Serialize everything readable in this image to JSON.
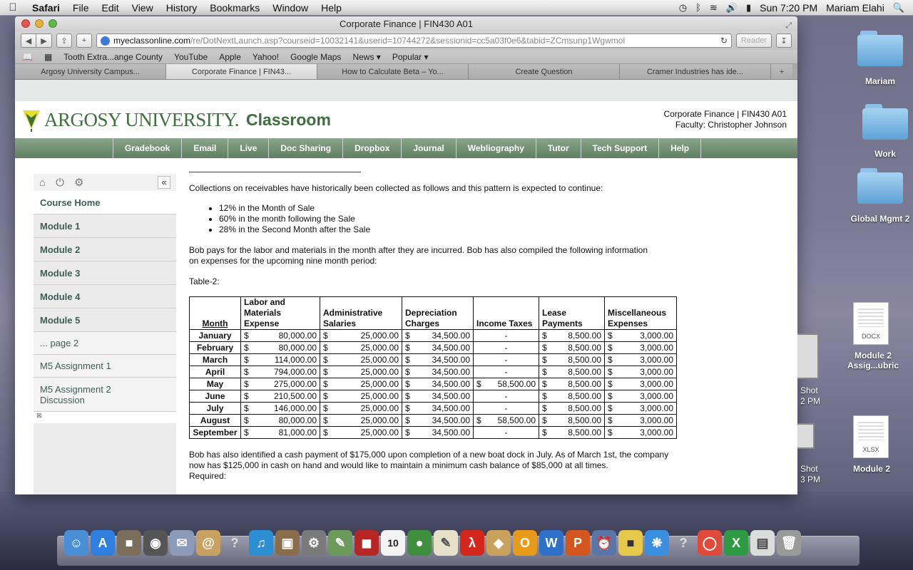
{
  "menubar": {
    "app": "Safari",
    "items": [
      "File",
      "Edit",
      "View",
      "History",
      "Bookmarks",
      "Window",
      "Help"
    ],
    "clock": "Sun 7:20 PM",
    "user": "Mariam Elahi"
  },
  "window": {
    "title": "Corporate Finance | FIN430 A01",
    "url_host": "myeclassonline.com",
    "url_path": "/re/DotNextLaunch.asp?courseid=10032141&userid=10744272&sessionid=cc5a03f0e6&tabid=ZCmsunp1Wgwmol",
    "reader": "Reader"
  },
  "bookmarks": [
    "Tooth Extra...ange County",
    "YouTube",
    "Apple",
    "Yahoo!",
    "Google Maps",
    "News ▾",
    "Popular ▾"
  ],
  "tabs": [
    "Argosy University Campus...",
    "Corporate Finance | FIN43...",
    "How to Calculate Beta – Yo...",
    "Create Question",
    "Cramer Industries has ide..."
  ],
  "site": {
    "logo_text": "ARGOSY UNIVERSITY.",
    "logo_classroom": "Classroom",
    "course_line1": "Corporate Finance | FIN430 A01",
    "course_line2": "Faculty:  Christopher Johnson"
  },
  "nav": [
    "Gradebook",
    "Email",
    "Live",
    "Doc Sharing",
    "Dropbox",
    "Journal",
    "Webliography",
    "Tutor",
    "Tech Support",
    "Help"
  ],
  "sidebar": {
    "collapse": "«",
    "items": [
      "Course Home",
      "Module 1",
      "Module 2",
      "Module 3",
      "Module 4",
      "Module 5"
    ],
    "sub_items": [
      "... page 2",
      "M5 Assignment 1"
    ],
    "sub_tall": [
      "M5 Assignment 2",
      "Discussion"
    ]
  },
  "main": {
    "intro": "Collections on receivables have historically been collected as follows and this pattern is expected to continue:",
    "bullets": [
      "12% in the Month of Sale",
      "60% in the month following the Sale",
      "28% in the Second Month after the Sale"
    ],
    "para2": "Bob pays for the labor and materials in the month after they are incurred.  Bob has also compiled the following information on expenses for the upcoming nine month period:",
    "table_label": "Table-2:",
    "headers": [
      "Month",
      "Labor and Materials Expense",
      "Administrative Salaries",
      "Depreciation Charges",
      "Income Taxes",
      "Lease Payments",
      "Miscellaneous Expenses"
    ],
    "rows": [
      [
        "January",
        "80,000.00",
        "25,000.00",
        "34,500.00",
        "-",
        "8,500.00",
        "3,000.00"
      ],
      [
        "February",
        "80,000.00",
        "25,000.00",
        "34,500.00",
        "-",
        "8,500.00",
        "3,000.00"
      ],
      [
        "March",
        "114,000.00",
        "25,000.00",
        "34,500.00",
        "-",
        "8,500.00",
        "3,000.00"
      ],
      [
        "April",
        "794,000.00",
        "25,000.00",
        "34,500.00",
        "-",
        "8,500.00",
        "3,000.00"
      ],
      [
        "May",
        "275,000.00",
        "25,000.00",
        "34,500.00",
        "58,500.00",
        "8,500.00",
        "3,000.00"
      ],
      [
        "June",
        "210,500.00",
        "25,000.00",
        "34,500.00",
        "-",
        "8,500.00",
        "3,000.00"
      ],
      [
        "July",
        "146,000.00",
        "25,000.00",
        "34,500.00",
        "-",
        "8,500.00",
        "3,000.00"
      ],
      [
        "August",
        "80,000.00",
        "25,000.00",
        "34,500.00",
        "58,500.00",
        "8,500.00",
        "3,000.00"
      ],
      [
        "September",
        "81,000.00",
        "25,000.00",
        "34,500.00",
        "-",
        "8,500.00",
        "3,000.00"
      ]
    ],
    "currency": "$",
    "para3": " Bob has also identified a cash payment of $175,000 upon completion of a new boat dock in July.  As of March 1st, the company now has $125,000 in cash on hand and would like to maintain a minimum cash balance of $85,000 at all times.",
    "required": "Required:"
  },
  "desktop": {
    "folders": [
      "Mariam",
      "Work",
      "Global Mgmt 2"
    ],
    "doc1": {
      "ext": "DOCX",
      "label": "Module 2 Assig...ubric"
    },
    "doc2": {
      "ext": "XLSX",
      "label": "Module 2"
    },
    "partial1": "Shot",
    "partial1b": "2 PM",
    "partial2": "Shot",
    "partial2b": "3 PM"
  },
  "colors": {
    "brand_green": "#3f6f3e",
    "nav_green": "#6f8f71",
    "sidebar_text": "#3c5e57"
  }
}
